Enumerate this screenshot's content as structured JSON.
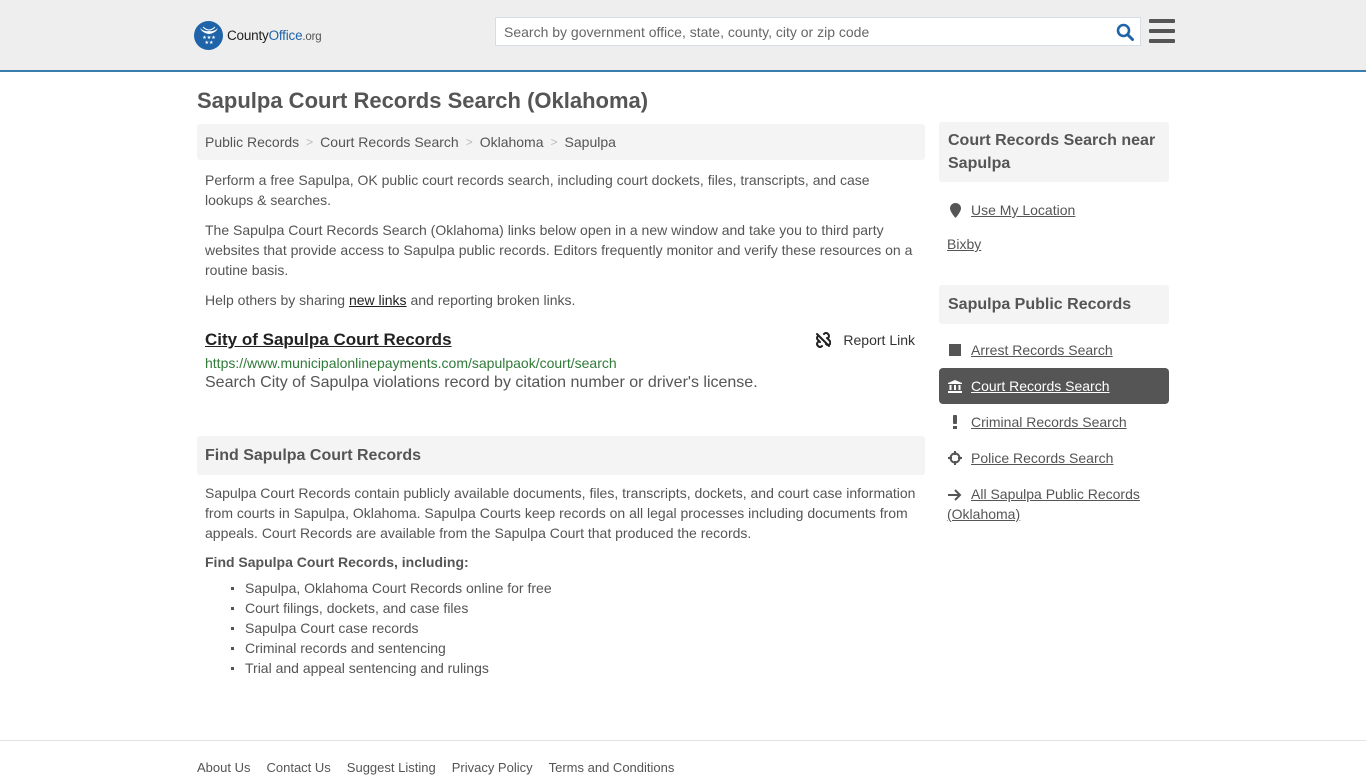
{
  "header": {
    "logo": {
      "county": "County",
      "office": "Office",
      "org": ".org"
    },
    "search_placeholder": "Search by government office, state, county, city or zip code",
    "icons": {
      "search": "search-icon",
      "menu": "hamburger-menu-icon",
      "logo": "eagle-stars-badge-icon"
    }
  },
  "page": {
    "title": "Sapulpa Court Records Search (Oklahoma)"
  },
  "breadcrumb": [
    {
      "label": "Public Records"
    },
    {
      "label": "Court Records Search"
    },
    {
      "label": "Oklahoma"
    },
    {
      "label": "Sapulpa"
    }
  ],
  "breadcrumb_separator": ">",
  "intro": {
    "p1": "Perform a free Sapulpa, OK public court records search, including court dockets, files, transcripts, and case lookups & searches.",
    "p2": "The Sapulpa Court Records Search (Oklahoma) links below open in a new window and take you to third party websites that provide access to Sapulpa public records. Editors frequently monitor and verify these resources on a routine basis.",
    "p3_before": "Help others by sharing ",
    "p3_link": "new links",
    "p3_after": " and reporting broken links."
  },
  "listings": [
    {
      "title": "City of Sapulpa Court Records",
      "url": "https://www.municipalonlinepayments.com/sapulpaok/court/search",
      "description": "Search City of Sapulpa violations record by citation number or driver's license.",
      "report_label": "Report Link",
      "report_icon": "broken-link-icon"
    }
  ],
  "find_section": {
    "heading": "Find Sapulpa Court Records",
    "body": "Sapulpa Court Records contain publicly available documents, files, transcripts, dockets, and court case information from courts in Sapulpa, Oklahoma. Sapulpa Courts keep records on all legal processes including documents from appeals. Court Records are available from the Sapulpa Court that produced the records.",
    "subheading": "Find Sapulpa Court Records, including:",
    "items": [
      "Sapulpa, Oklahoma Court Records online for free",
      "Court filings, dockets, and case files",
      "Sapulpa Court case records",
      "Criminal records and sentencing",
      "Trial and appeal sentencing and rulings"
    ]
  },
  "sidebar": {
    "near": {
      "heading": "Court Records Search near Sapulpa",
      "use_location": "Use My Location",
      "location_icon": "map-marker-icon",
      "places": [
        "Bixby"
      ]
    },
    "public_records": {
      "heading": "Sapulpa Public Records",
      "items": [
        {
          "label": "Arrest Records Search",
          "icon": "square-icon",
          "active": false
        },
        {
          "label": "Court Records Search",
          "icon": "courthouse-icon",
          "active": true
        },
        {
          "label": "Criminal Records Search",
          "icon": "exclamation-icon",
          "active": false
        },
        {
          "label": "Police Records Search",
          "icon": "crosshair-icon",
          "active": false
        },
        {
          "label": "All Sapulpa Public Records (Oklahoma)",
          "icon": "arrow-right-icon",
          "active": false
        }
      ]
    }
  },
  "footer": {
    "links": [
      "About Us",
      "Contact Us",
      "Suggest Listing",
      "Privacy Policy",
      "Terms and Conditions"
    ]
  },
  "colors": {
    "brand_blue": "#1f64a8",
    "header_border": "#3a7cab",
    "url_green": "#317a3a",
    "active_bg": "#555555",
    "panel_bg": "#f4f4f4"
  }
}
